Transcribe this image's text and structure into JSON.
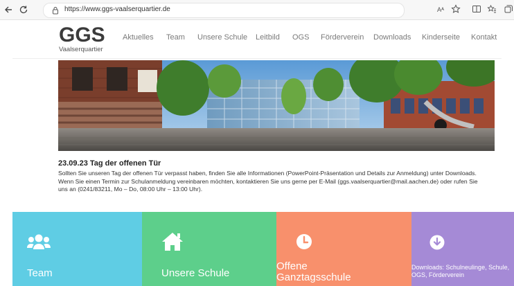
{
  "browser": {
    "url": "https://www.ggs-vaalserquartier.de",
    "reader_label": "Aᴬ"
  },
  "site": {
    "logo": "GGS",
    "logo_sub": "Vaalserquartier",
    "menu": [
      "Aktuelles",
      "Team",
      "Unsere Schule",
      "Leitbild",
      "OGS",
      "Förderverein",
      "Downloads",
      "Kinderseite",
      "Kontakt"
    ]
  },
  "news": {
    "title": "23.09.23 Tag der offenen Tür",
    "lines": [
      "Sollten Sie unseren Tag der offenen Tür verpasst haben, finden Sie alle Informationen (PowerPoint-Präsentation und Details zur Anmeldung) unter Downloads.",
      "Wenn Sie einen Termin zur Schulanmeldung vereinbaren möchten, kontaktieren Sie uns gerne per E-Mail (ggs.vaalserquartier@mail.aachen.de) oder rufen Sie",
      "uns an (0241/83211, Mo – Do, 08:00 Uhr – 13:00 Uhr)."
    ]
  },
  "tiles": [
    {
      "label": "Team",
      "color": "#5fcde4",
      "icon": "users-icon"
    },
    {
      "label": "Unsere Schule",
      "color": "#5dcf8b",
      "icon": "home-icon"
    },
    {
      "label": "Offene Ganztagsschule",
      "color": "#f8906c",
      "icon": "clock-icon"
    },
    {
      "label": "Downloads: Schulneulinge, Schule, OGS, Förderverein",
      "color": "#a58ad6",
      "icon": "download-icon"
    }
  ],
  "colors": {
    "logo": "#3b3b3b",
    "menu_text": "#7a7a7a"
  }
}
